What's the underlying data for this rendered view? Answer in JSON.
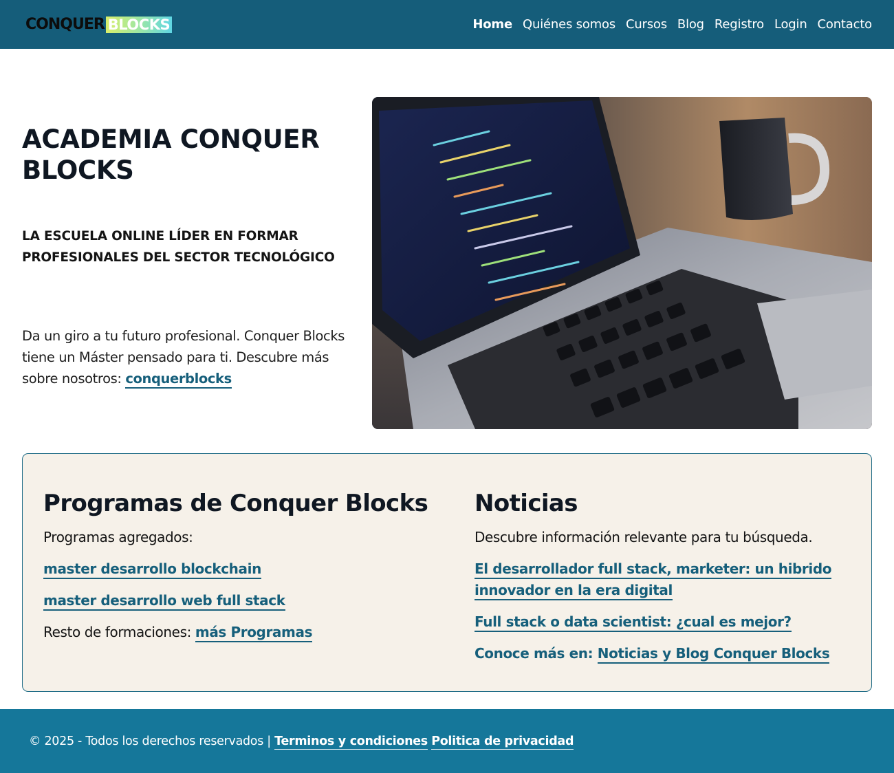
{
  "header": {
    "logo": {
      "part1": "CONQUER",
      "part2": "BLOCKS"
    },
    "nav": [
      {
        "label": "Home",
        "active": true
      },
      {
        "label": "Quiénes somos",
        "active": false
      },
      {
        "label": "Cursos",
        "active": false
      },
      {
        "label": "Blog",
        "active": false
      },
      {
        "label": "Registro",
        "active": false
      },
      {
        "label": "Login",
        "active": false
      },
      {
        "label": "Contacto",
        "active": false
      }
    ]
  },
  "hero": {
    "title": "ACADEMIA CONQUER BLOCKS",
    "subtitle": "LA ESCUELA ONLINE LÍDER EN FORMAR PROFESIONALES DEL SECTOR TECNOLÓGICO",
    "text": "Da un giro a tu futuro profesional. Conquer Blocks tiene un Máster pensado para ti. Descubre más sobre nosotros: ",
    "link_label": "conquerblocks"
  },
  "programs": {
    "heading": "Programas de Conquer Blocks",
    "intro": "Programas agregados:",
    "links": [
      "master desarrollo blockchain",
      "master desarrollo web full stack"
    ],
    "rest_prefix": "Resto de formaciones: ",
    "rest_link": "más Programas"
  },
  "news": {
    "heading": "Noticias",
    "intro": "Descubre información relevante para tu búsqueda.",
    "links": [
      "El desarrollador full stack, marketer: un hibrido innovador en la era digital",
      "Full stack o data scientist: ¿cual es mejor?"
    ],
    "more_prefix": "Conoce más en: ",
    "more_link": "Noticias y Blog Conquer Blocks"
  },
  "footer": {
    "copyright": "© 2025 - Todos los derechos reservados | ",
    "terms": "Terminos y condiciones",
    "privacy": "Politica de privacidad"
  },
  "colors": {
    "header_bg": "#155d7a",
    "footer_bg": "#15779a",
    "link": "#165f7b",
    "card_bg": "#f6f1e9"
  }
}
